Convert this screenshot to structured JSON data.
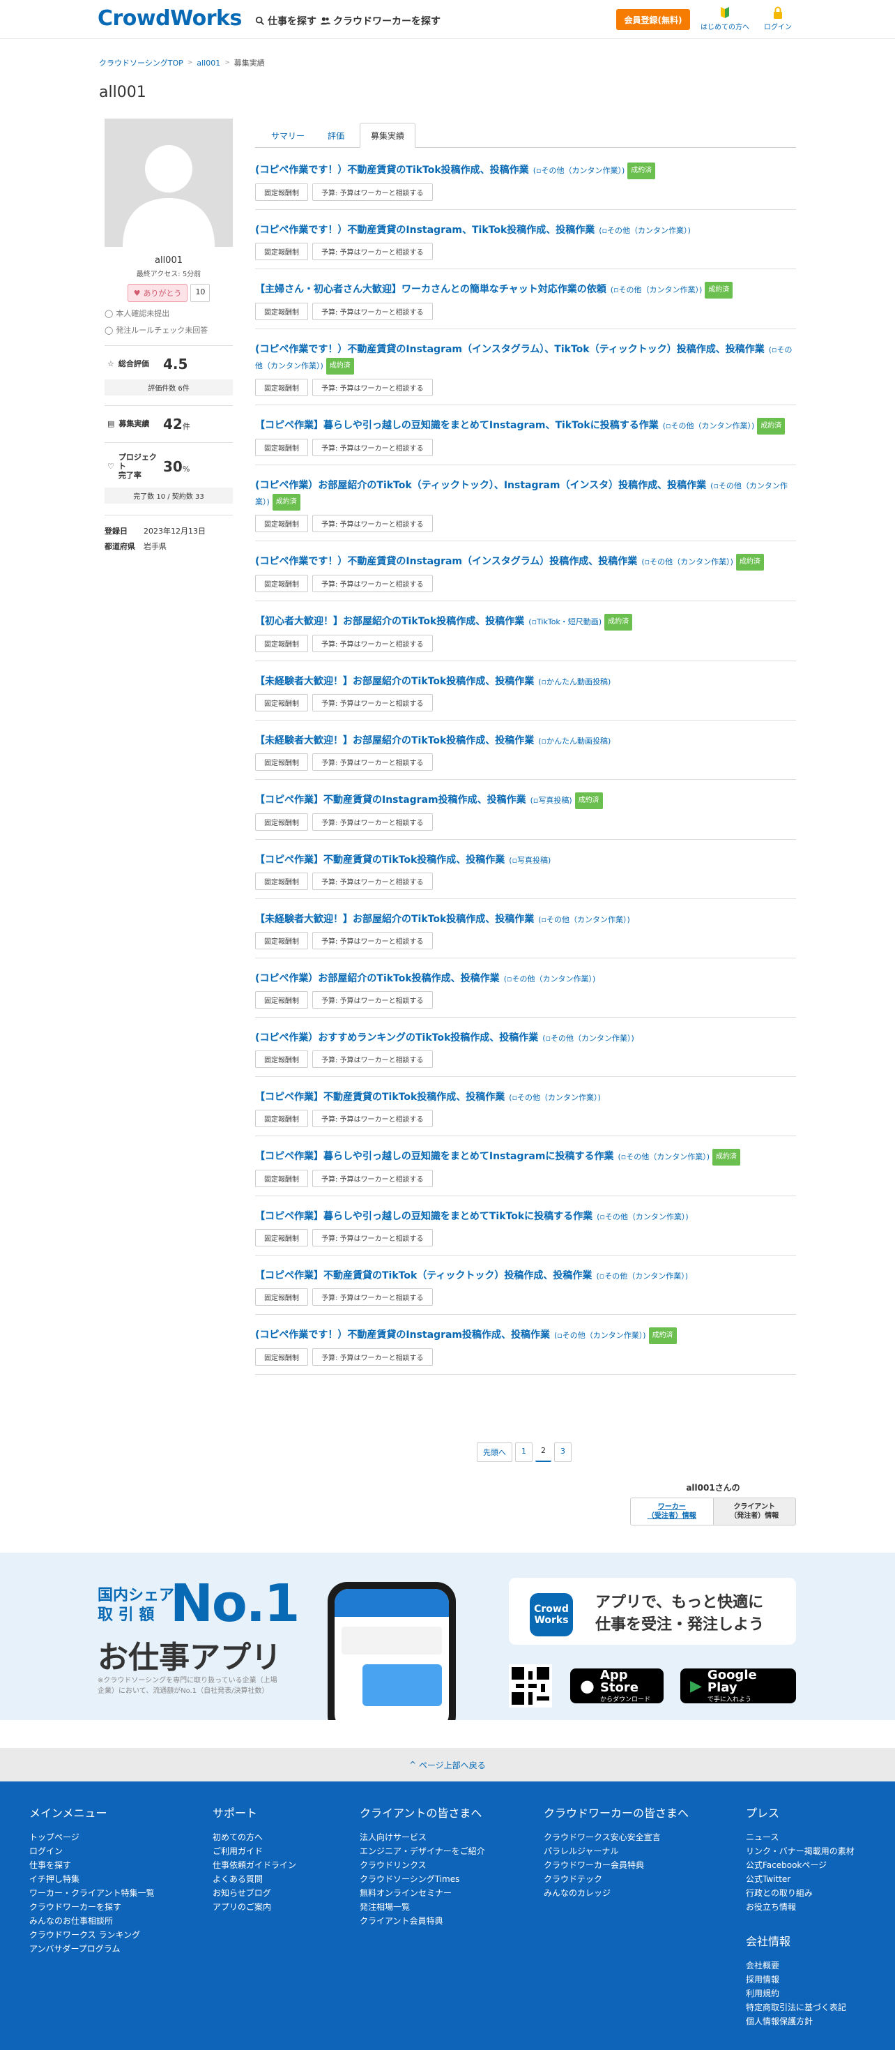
{
  "header": {
    "logo": "CrowdWorks",
    "nav_find_jobs": "仕事を探す",
    "nav_find_workers": "クラウドワーカーを探す",
    "register": "会員登録(無料)",
    "beginner": "はじめての方へ",
    "login": "ログイン"
  },
  "breadcrumb": [
    "クラウドソーシングTOP",
    "all001",
    "募集実績"
  ],
  "profile": {
    "username": "all001",
    "name": "all001",
    "last_access": "最終アクセス: 5分前",
    "thanks_label": "ありがとう",
    "thanks_count": "10",
    "check1": "本人確認未提出",
    "check2": "発注ルールチェック未回答",
    "rating_label": "総合評価",
    "rating_value": "4.5",
    "rating_count": "評価件数 6件",
    "jobs_label": "募集実績",
    "jobs_value": "42",
    "jobs_unit": "件",
    "complete_label1": "プロジェクト",
    "complete_label2": "完了率",
    "complete_value": "30",
    "complete_unit": "%",
    "complete_sub": "完了数 10 / 契約数 33",
    "reg_label": "登録日",
    "reg_value": "2023年12月13日",
    "pref_label": "都道府県",
    "pref_value": "岩手県"
  },
  "tabs": [
    "サマリー",
    "評価",
    "募集実績"
  ],
  "tags": {
    "fixed": "固定報酬制",
    "budget": "予算: 予算はワーカーと相談する"
  },
  "badge_text": "成約済",
  "jobs": [
    {
      "title": "(コピペ作業です！）不動産賃貸のTikTok投稿作成、投稿作業",
      "cat": "その他（カンタン作業）",
      "badge": true
    },
    {
      "title": "(コピペ作業です！）不動産賃貸のInstagram、TikTok投稿作成、投稿作業",
      "cat": "その他（カンタン作業）",
      "badge": false
    },
    {
      "title": "【主婦さん・初心者さん大歓迎】ワーカさんとの簡単なチャット対応作業の依頼",
      "cat": "その他（カンタン作業）",
      "badge": true
    },
    {
      "title": "(コピペ作業です！）不動産賃貸のInstagram（インスタグラム）、TikTok（ティックトック）投稿作成、投稿作業",
      "cat": "その他（カンタン作業）",
      "badge": true
    },
    {
      "title": "【コピペ作業】暮らしや引っ越しの豆知識をまとめてInstagram、TikTokに投稿する作業",
      "cat": "その他（カンタン作業）",
      "badge": true
    },
    {
      "title": "(コピペ作業）お部屋紹介のTikTok（ティックトック）、Instagram（インスタ）投稿作成、投稿作業",
      "cat": "その他（カンタン作業）",
      "badge": true
    },
    {
      "title": "(コピペ作業です！）不動産賃貸のInstagram（インスタグラム）投稿作成、投稿作業",
      "cat": "その他（カンタン作業）",
      "badge": true
    },
    {
      "title": "【初心者大歓迎！】お部屋紹介のTikTok投稿作成、投稿作業",
      "cat": "TikTok・短尺動画",
      "badge": true
    },
    {
      "title": "【未経験者大歓迎！】お部屋紹介のTikTok投稿作成、投稿作業",
      "cat": "かんたん動画投稿",
      "badge": false
    },
    {
      "title": "【未経験者大歓迎！】お部屋紹介のTikTok投稿作成、投稿作業",
      "cat": "かんたん動画投稿",
      "badge": false
    },
    {
      "title": "【コピペ作業】不動産賃貸のInstagram投稿作成、投稿作業",
      "cat": "写真投稿",
      "badge": true
    },
    {
      "title": "【コピペ作業】不動産賃貸のTikTok投稿作成、投稿作業",
      "cat": "写真投稿",
      "badge": false
    },
    {
      "title": "【未経験者大歓迎！】お部屋紹介のTikTok投稿作成、投稿作業",
      "cat": "その他（カンタン作業）",
      "badge": false
    },
    {
      "title": "(コピペ作業）お部屋紹介のTikTok投稿作成、投稿作業",
      "cat": "その他（カンタン作業）",
      "badge": false
    },
    {
      "title": "(コピペ作業）おすすめランキングのTikTok投稿作成、投稿作業",
      "cat": "その他（カンタン作業）",
      "badge": false
    },
    {
      "title": "【コピペ作業】不動産賃貸のTikTok投稿作成、投稿作業",
      "cat": "その他（カンタン作業）",
      "badge": false
    },
    {
      "title": "【コピペ作業】暮らしや引っ越しの豆知識をまとめてInstagramに投稿する作業",
      "cat": "その他（カンタン作業）",
      "badge": true
    },
    {
      "title": "【コピペ作業】暮らしや引っ越しの豆知識をまとめてTikTokに投稿する作業",
      "cat": "その他（カンタン作業）",
      "badge": false
    },
    {
      "title": "【コピペ作業】不動産賃貸のTikTok（ティックトック）投稿作成、投稿作業",
      "cat": "その他（カンタン作業）",
      "badge": false
    },
    {
      "title": "(コピペ作業です！）不動産賃貸のInstagram投稿作成、投稿作業",
      "cat": "その他（カンタン作業）",
      "badge": true
    }
  ],
  "pagination": [
    "先頭へ",
    "1",
    "2",
    "3"
  ],
  "user_card": {
    "title": "all001さんの",
    "worker": "ワーカー\n（受注者）情報",
    "client": "クライアント\n（発注者）情報"
  },
  "app": {
    "share1": "国内シェア",
    "share2": "取 引 額",
    "no1": "No.1",
    "appword": "お仕事アプリ",
    "note": "※クラウドソーシングを専門に取り扱っている企業（上場企業）において、流通額がNo.1（自社発表/決算社数）",
    "logo": "Crowd\nWorks",
    "title1": "アプリで、もっと快適に",
    "title2": "仕事を受注・発注しよう",
    "appstore1": "App Store",
    "appstore2": "からダウンロード",
    "gplay1": "Google Play",
    "gplay2": "で手に入れよう"
  },
  "to_top": "ページ上部へ戻る",
  "footer": {
    "main": {
      "h": "メインメニュー",
      "items": [
        "トップページ",
        "ログイン",
        "仕事を探す",
        "イチ押し特集",
        "ワーカー・クライアント特集一覧",
        "クラウドワーカーを探す",
        "みんなのお仕事相談所",
        "クラウドワークス ランキング",
        "アンバサダープログラム"
      ]
    },
    "support": {
      "h": "サポート",
      "items": [
        "初めての方へ",
        "ご利用ガイド",
        "仕事依頼ガイドライン",
        "よくある質問",
        "お知らせブログ",
        "アプリのご案内"
      ]
    },
    "client": {
      "h": "クライアントの皆さまへ",
      "items": [
        "法人向けサービス",
        "エンジニア・デザイナーをご紹介",
        "クラウドリンクス",
        "クラウドソーシングTimes",
        "無料オンラインセミナー",
        "発注相場一覧",
        "クライアント会員特典"
      ]
    },
    "worker": {
      "h": "クラウドワーカーの皆さまへ",
      "items": [
        "クラウドワークス安心安全宣言",
        "パラレルジャーナル",
        "クラウドワーカー会員特典",
        "クラウドテック",
        "みんなのカレッジ"
      ]
    },
    "press": {
      "h": "プレス",
      "items": [
        "ニュース",
        "リンク・バナー掲載用の素材",
        "公式Facebookページ",
        "公式Twitter",
        "行政との取り組み",
        "お役立ち情報"
      ]
    },
    "company": {
      "h": "会社情報",
      "items": [
        "会社概要",
        "採用情報",
        "利用規約",
        "特定商取引法に基づく表記",
        "個人情報保護方針"
      ]
    }
  }
}
